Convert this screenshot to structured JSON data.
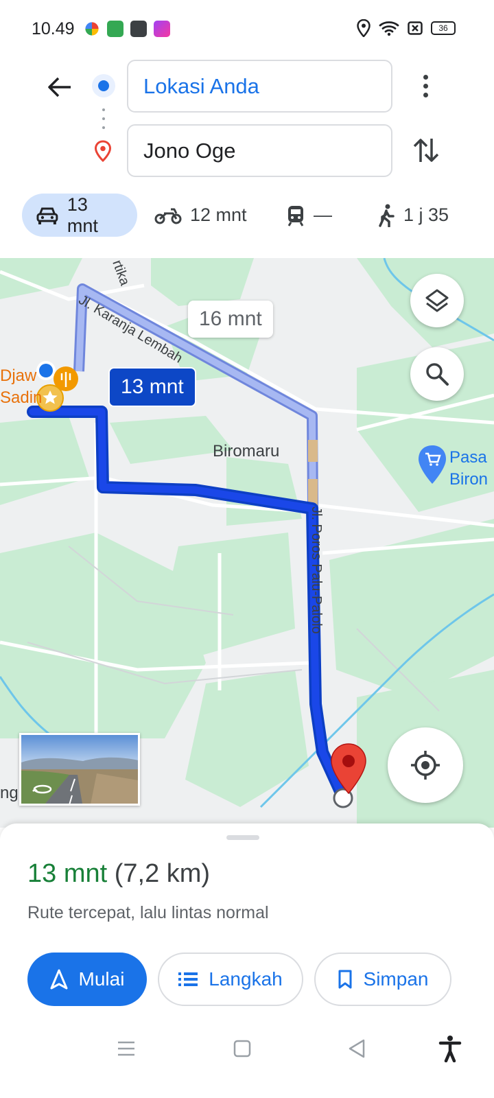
{
  "status_bar": {
    "time": "10.49",
    "battery": "36",
    "notification_icons": [
      "photos-icon",
      "shopping-icon",
      "game-icon",
      "shortcut-icon"
    ],
    "system_icons": [
      "location-icon",
      "wifi-icon",
      "sim-off-icon",
      "battery-icon"
    ]
  },
  "directions": {
    "origin": "Lokasi Anda",
    "destination": "Jono Oge"
  },
  "modes": [
    {
      "name": "car",
      "label": "13 mnt",
      "active": true
    },
    {
      "name": "motorcycle",
      "label": "12 mnt",
      "active": false
    },
    {
      "name": "transit",
      "label": "—",
      "active": false
    },
    {
      "name": "walk",
      "label": "1 j 35",
      "active": false
    }
  ],
  "map": {
    "main_route_time": "13 mnt",
    "alt_route_time": "16 mnt",
    "labels": {
      "biromaru": "Biromaru",
      "pasar": [
        "Pasa",
        "Biron"
      ],
      "djaw": [
        "Djaw",
        "Sadin"
      ],
      "ng": "ng",
      "road_karanja": "Jl. Karanja Lembah",
      "road_poros": "Jl. Poros Palu-Palolo",
      "road_kartika": "rtika"
    },
    "colors": {
      "route_main": "#1a47e8",
      "route_alt": "#a7b8f2",
      "destination_pin": "#ea4335",
      "green_area": "#c9ecd3"
    }
  },
  "summary": {
    "duration": "13 mnt",
    "distance": "(7,2 km)",
    "description": "Rute tercepat, lalu lintas normal"
  },
  "actions": {
    "start": "Mulai",
    "steps": "Langkah",
    "save": "Simpan"
  }
}
